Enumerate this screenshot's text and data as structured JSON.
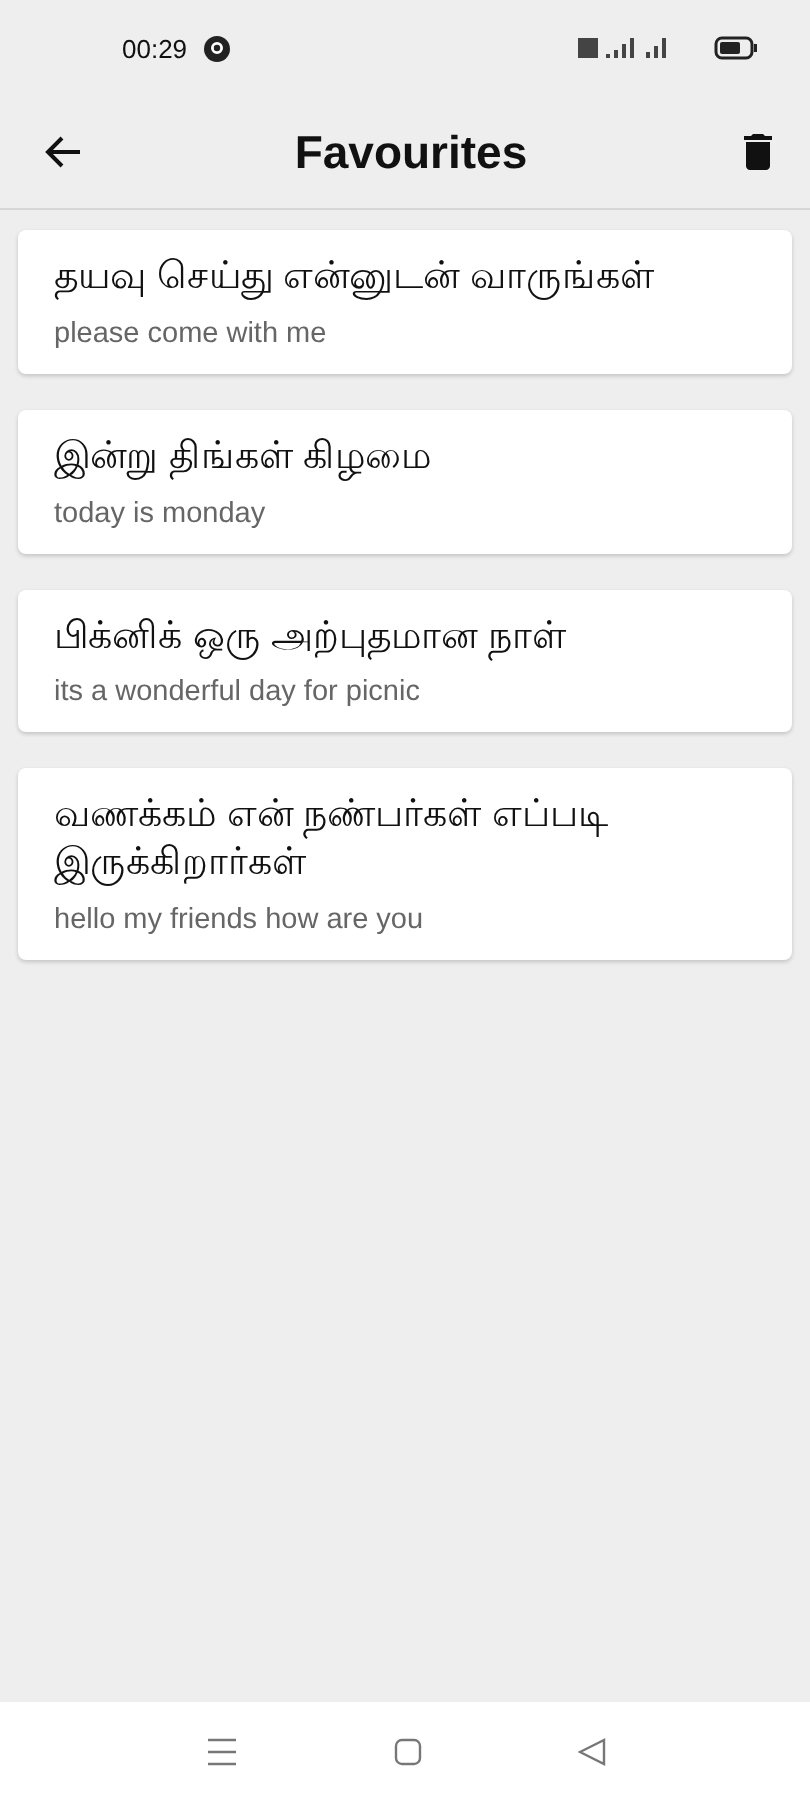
{
  "status_bar": {
    "time": "00:29"
  },
  "app_bar": {
    "title": "Favourites"
  },
  "favourites": [
    {
      "tamil": "தயவு செய்து என்னுடன் வாருங்கள்",
      "english": "please come with me"
    },
    {
      "tamil": "இன்று திங்கள் கிழமை",
      "english": "today is monday"
    },
    {
      "tamil": "பிக்னிக் ஒரு அற்புதமான நாள்",
      "english": "its a wonderful day for picnic"
    },
    {
      "tamil": "வணக்கம் என் நண்பர்கள் எப்படி இருக்கிறார்கள்",
      "english": "hello my friends how are you"
    }
  ]
}
